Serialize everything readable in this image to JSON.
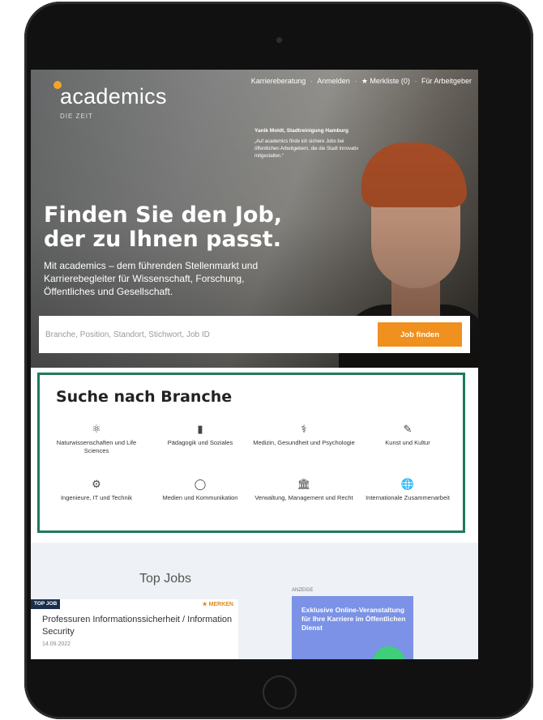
{
  "brand": {
    "name": "academics",
    "sub": "DIE ZEIT"
  },
  "nav": {
    "karriere": "Karriereberatung",
    "anmelden": "Anmelden",
    "merkliste": "★ Merkliste (0)",
    "arbeitgeber": "Für Arbeitgeber"
  },
  "quote": {
    "who": "Yanik Moldt, Stadtreinigung Hamburg",
    "text": "„Auf academics finde ich sichere Jobs bei öffentlichen Arbeitgebern, die die Stadt innovativ mitgestalten.“"
  },
  "hero": {
    "headline_1": "Finden Sie den Job,",
    "headline_2": "der zu Ihnen passt.",
    "subline": "Mit academics – dem führenden Stellenmarkt und Karrierebegleiter für Wissenschaft, Forschung, Öffentliches und Gesellschaft."
  },
  "search": {
    "placeholder": "Branche, Position, Standort, Stichwort, Job ID",
    "button": "Job finden"
  },
  "branche": {
    "title": "Suche nach Branche",
    "items": [
      {
        "icon": "atom-icon",
        "label": "Naturwissenschaften und Life Sciences"
      },
      {
        "icon": "book-icon",
        "label": "Pädagogik und Soziales"
      },
      {
        "icon": "stethoscope-icon",
        "label": "Medizin, Gesundheit und Psychologie"
      },
      {
        "icon": "brush-icon",
        "label": "Kunst und Kultur"
      },
      {
        "icon": "gear-icon",
        "label": "Ingenieure, IT und Technik"
      },
      {
        "icon": "speech-bubble-icon",
        "label": "Medien und Kommunikation"
      },
      {
        "icon": "institution-icon",
        "label": "Verwaltung, Management und Recht"
      },
      {
        "icon": "globe-icon",
        "label": "Internationale Zusammenarbeit"
      }
    ]
  },
  "topjobs": {
    "title": "Top Jobs",
    "badge": "TOP JOB",
    "merken": "★ MERKEN",
    "job_title": "Professuren Informationssicherheit / Information Security",
    "job_date": "14.09.2022"
  },
  "ad": {
    "label": "ANZEIGE",
    "text": "Exklusive Online-Veranstaltung für Ihre Karriere im Öffentlichen Dienst"
  },
  "colors": {
    "accent": "#f0901e",
    "highlight_border": "#1f7a5c",
    "badge": "#1a2f4b",
    "ad": "#7b92e6"
  }
}
